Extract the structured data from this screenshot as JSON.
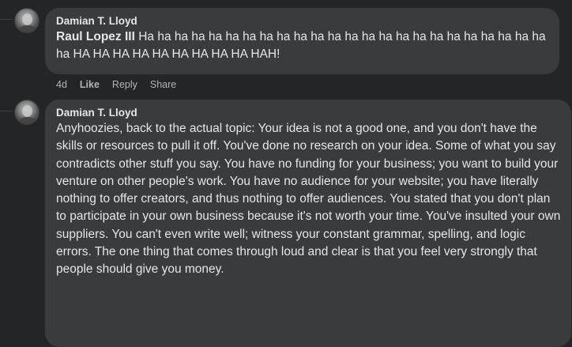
{
  "comments": [
    {
      "author": "Damian T. Lloyd",
      "mention": "Raul Lopez III",
      "text": " Ha ha ha ha ha ha ha ha ha ha ha ha ha ha ha ha ha ha ha ha ha ha ha ha ha HA HA HA HA HA HA HA HA HA HAH!",
      "actions": {
        "age": "4d",
        "like": "Like",
        "reply": "Reply",
        "share": "Share"
      }
    },
    {
      "author": "Damian T. Lloyd",
      "text": "Anyhoozies, back to the actual topic: Your idea is not a good one, and you don't have the skills or resources to pull it off. You've done no research on your idea. Some of what you say contradicts other stuff you say. You have no funding for your business; you want to build your venture on other people's work. You have no audience for your website; you have literally nothing to offer creators, and thus nothing to offer audiences. You stated that you don't plan to participate in your own business because it's not worth your time. You've insulted your own suppliers. You can't even write well; witness your constant grammar, spelling, and logic errors. The one thing that comes through loud and clear is that you feel very strongly that people should give you money."
    }
  ]
}
